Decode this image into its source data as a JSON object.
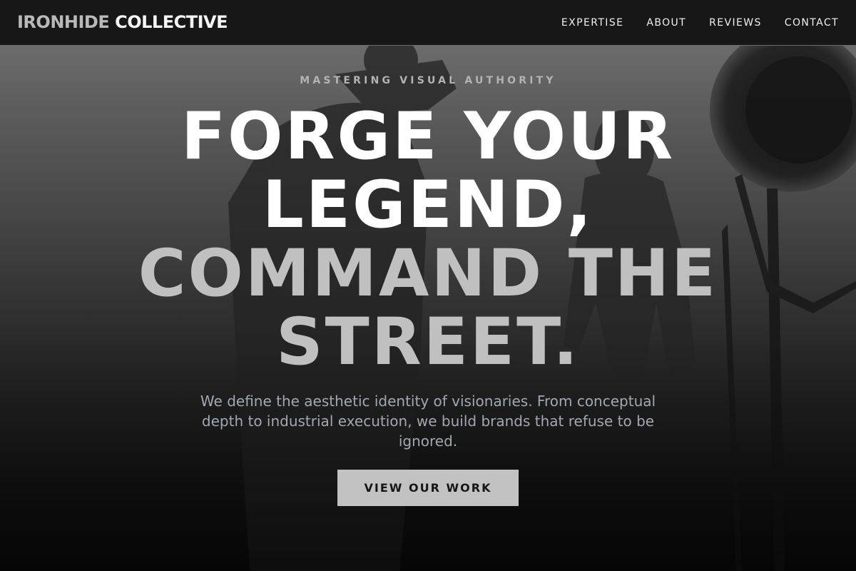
{
  "header": {
    "logo_part1": "IRONHIDE",
    "logo_part2": "COLLECTIVE",
    "nav": [
      {
        "label": "EXPERTISE"
      },
      {
        "label": "ABOUT"
      },
      {
        "label": "REVIEWS"
      },
      {
        "label": "CONTACT"
      }
    ]
  },
  "hero": {
    "eyebrow": "MASTERING VISUAL AUTHORITY",
    "headline_line1": "FORGE YOUR",
    "headline_line2": "LEGEND,",
    "headline_line3": "COMMAND THE",
    "headline_line4": "STREET.",
    "lede": "We define the aesthetic identity of visionaries. From conceptual depth to industrial execution, we build brands that refuse to be ignored.",
    "cta_label": "VIEW OUR WORK"
  },
  "colors": {
    "header_bg": "#171717",
    "hero_dark": "#121212",
    "headline_white": "#ffffff",
    "headline_gray": "#c0c0c0",
    "cta_bg": "#c2c2c2"
  }
}
